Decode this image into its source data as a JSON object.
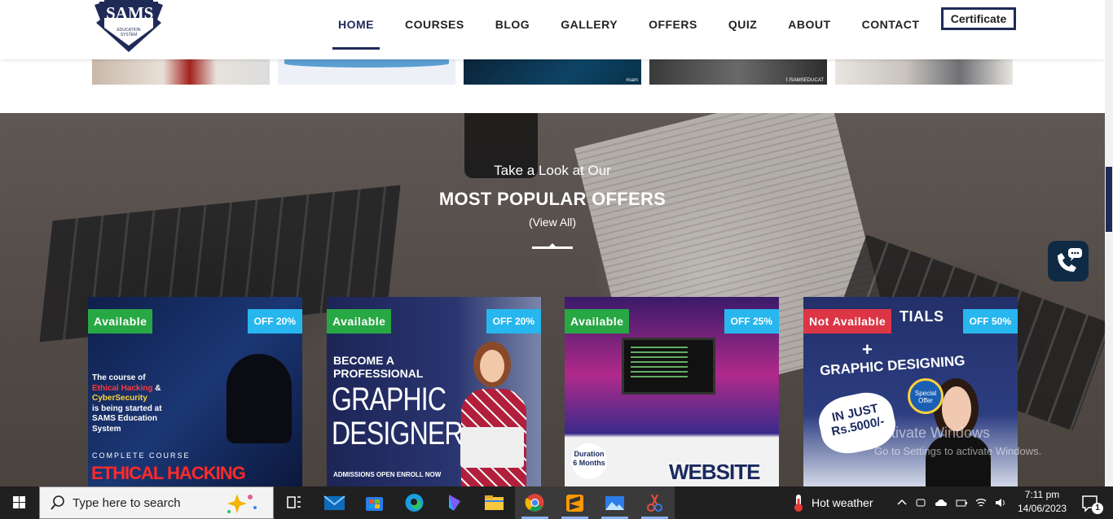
{
  "brand": {
    "logo_text": "SAMS",
    "logo_sub": "EDUCATION SYSTEM"
  },
  "nav": {
    "items": [
      "HOME",
      "COURSES",
      "BLOG",
      "GALLERY",
      "OFFERS",
      "QUIZ",
      "ABOUT",
      "CONTACT"
    ],
    "active": "HOME",
    "certificate_label": "Certificate",
    "accent_color": "#1f2a57"
  },
  "gallery": {
    "tags": [
      "#sam",
      "f /SAMSEDUCAT"
    ]
  },
  "offers": {
    "subtitle": "Take a Look at Our",
    "title": "MOST POPULAR OFFERS",
    "view_all": "(View All)",
    "cards": [
      {
        "status": "Available",
        "status_color": "#28a745",
        "discount": "OFF 20%",
        "art_lines": [
          "The course of",
          "Ethical Hacking",
          "&",
          "CyberSecurity",
          "is being started at SAMS Education System"
        ],
        "art_footer": "COMPLETE COURSE",
        "art_title": "ETHICAL HACKING"
      },
      {
        "status": "Available",
        "status_color": "#28a745",
        "discount": "OFF 20%",
        "art_lines": [
          "BECOME A",
          "PROFESSIONAL"
        ],
        "art_title": "GRAPHIC DESIGNER",
        "art_footer": "ADMISSIONS OPEN   ENROLL NOW"
      },
      {
        "status": "Available",
        "status_color": "#28a745",
        "discount": "OFF 25%",
        "art_badge": "Duration 6 Months",
        "art_title": "WEBSITE"
      },
      {
        "status": "Not Available",
        "status_color": "#dc3545",
        "discount": "OFF 50%",
        "art_lines": [
          "TIALS",
          "+"
        ],
        "art_title": "GRAPHIC DESIGNING",
        "art_price": "IN JUST Rs.5000/-",
        "art_special": "Special Offer"
      }
    ],
    "badge_color": "#27b6ee"
  },
  "watermark": {
    "line1": "Activate Windows",
    "line2": "Go to Settings to activate Windows."
  },
  "taskbar": {
    "search_placeholder": "Type here to search",
    "weather": "Hot weather",
    "time": "7:11 pm",
    "date": "14/06/2023",
    "notifications": "1",
    "icons": [
      "task-view-icon",
      "mail-icon",
      "store-icon",
      "edge-icon",
      "bing-chat-icon",
      "file-explorer-icon",
      "chrome-icon",
      "sublime-icon",
      "photos-icon",
      "snip-icon"
    ]
  }
}
